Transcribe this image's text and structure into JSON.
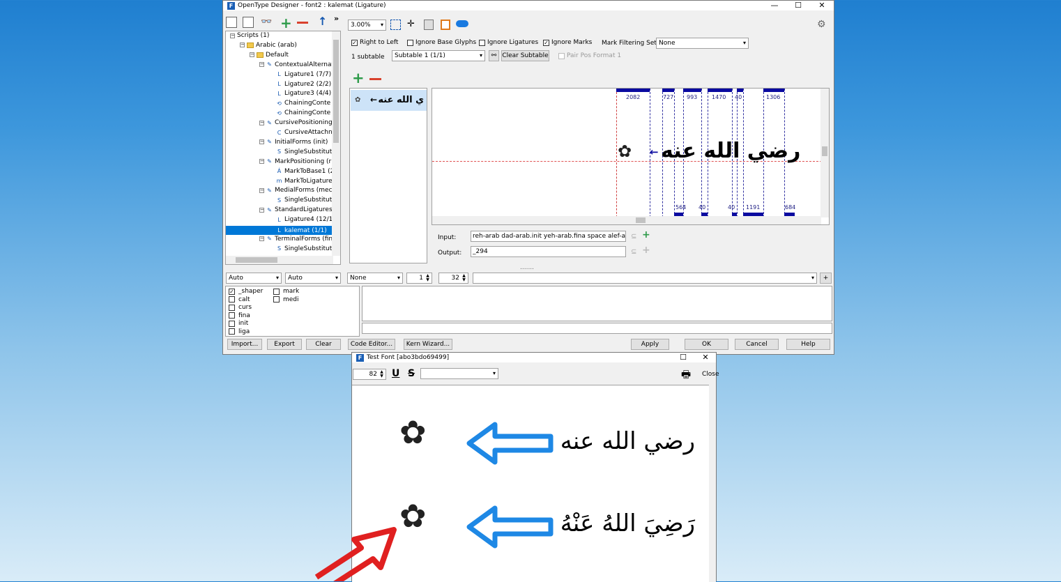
{
  "main_window": {
    "title": "OpenType Designer - font2 : kalemat (Ligature)",
    "min": "—",
    "max": "☐",
    "close": "✕"
  },
  "toolbar": {
    "zoom_value": "3.00%"
  },
  "lookup_options": {
    "right_to_left": "Right to Left",
    "ignore_base_glyphs": "Ignore Base Glyphs",
    "ignore_ligatures": "Ignore Ligatures",
    "ignore_marks": "Ignore Marks",
    "mark_filtering_set_label": "Mark Filtering Set:",
    "mark_filtering_set_value": "None",
    "subtable_count": "1 subtable",
    "subtable_value": "Subtable 1 (1/1)",
    "clear_subtable": "Clear Subtable",
    "pair_pos_format": "Pair Pos Format 1"
  },
  "tree": [
    {
      "label": "Scripts (1)",
      "depth": 0,
      "pm": "⊟",
      "icon": ""
    },
    {
      "label": "Arabic (arab)",
      "depth": 1,
      "pm": "⊟",
      "icon": "folder"
    },
    {
      "label": "Default",
      "depth": 2,
      "pm": "⊟",
      "icon": "folder"
    },
    {
      "label": "ContextualAlternat",
      "depth": 3,
      "pm": "⊟",
      "icon": "✎"
    },
    {
      "label": "Ligature1 (7/7)",
      "depth": 4,
      "pm": "",
      "icon": "L"
    },
    {
      "label": "Ligature2 (2/2)",
      "depth": 4,
      "pm": "",
      "icon": "L"
    },
    {
      "label": "Ligature3 (4/4)",
      "depth": 4,
      "pm": "",
      "icon": "L"
    },
    {
      "label": "ChainingConte",
      "depth": 4,
      "pm": "",
      "icon": "⟲"
    },
    {
      "label": "ChainingConte",
      "depth": 4,
      "pm": "",
      "icon": "⟲"
    },
    {
      "label": "CursivePositioning",
      "depth": 3,
      "pm": "⊟",
      "icon": "✎"
    },
    {
      "label": "CursiveAttachn",
      "depth": 4,
      "pm": "",
      "icon": "C"
    },
    {
      "label": "InitialForms (init)",
      "depth": 3,
      "pm": "⊟",
      "icon": "✎"
    },
    {
      "label": "SingleSubstitut",
      "depth": 4,
      "pm": "",
      "icon": "S"
    },
    {
      "label": "MarkPositioning (r",
      "depth": 3,
      "pm": "⊟",
      "icon": "✎"
    },
    {
      "label": "MarkToBase1 (2",
      "depth": 4,
      "pm": "",
      "icon": "Á"
    },
    {
      "label": "MarkToLigature",
      "depth": 4,
      "pm": "",
      "icon": "m"
    },
    {
      "label": "MedialForms (mec",
      "depth": 3,
      "pm": "⊟",
      "icon": "✎"
    },
    {
      "label": "SingleSubstitut",
      "depth": 4,
      "pm": "",
      "icon": "S"
    },
    {
      "label": "StandardLigatures",
      "depth": 3,
      "pm": "⊟",
      "icon": "✎"
    },
    {
      "label": "Ligature4 (12/1",
      "depth": 4,
      "pm": "",
      "icon": "L"
    },
    {
      "label": "kalemat (1/1)",
      "depth": 4,
      "pm": "",
      "icon": "L",
      "selected": true
    },
    {
      "label": "TerminalForms (fin",
      "depth": 3,
      "pm": "⊟",
      "icon": "✎"
    },
    {
      "label": "SingleSubstitut",
      "depth": 4,
      "pm": "",
      "icon": "S"
    }
  ],
  "glyph_list": {
    "entry_left": "ي الله عنه",
    "entry_arrow": "←"
  },
  "preview": {
    "top_numbers": [
      "2082",
      "727",
      "993",
      "1470",
      "40",
      "1306"
    ],
    "bottom_numbers": [
      "564",
      "40",
      "40",
      "1191",
      "684"
    ],
    "text": "رضي الله عنه",
    "arrow": "←"
  },
  "io": {
    "input_label": "Input:",
    "input_value": "reh-arab dad-arab.init yeh-arab.fina space alef-arab al",
    "output_label": "Output:",
    "output_value": "_294"
  },
  "bottom_controls": {
    "script": "Auto",
    "language": "Auto",
    "direction": "None",
    "size1": "1",
    "size2": "32",
    "add": "+"
  },
  "features_col1": [
    {
      "name": "_shaper",
      "checked": true
    },
    {
      "name": "calt",
      "checked": false
    },
    {
      "name": "curs",
      "checked": false
    },
    {
      "name": "fina",
      "checked": false
    },
    {
      "name": "init",
      "checked": false
    },
    {
      "name": "liga",
      "checked": false
    }
  ],
  "features_col2": [
    {
      "name": "mark",
      "checked": false
    },
    {
      "name": "medi",
      "checked": false
    }
  ],
  "buttons": {
    "import": "Import...",
    "export": "Export",
    "clear": "Clear",
    "code_editor": "Code Editor...",
    "kern_wizard": "Kern Wizard...",
    "apply": "Apply",
    "ok": "OK",
    "cancel": "Cancel",
    "help": "Help"
  },
  "test_window": {
    "title": "Test Font [abo3bdo69499]",
    "size": "82",
    "underline": "U",
    "strike": "S",
    "close": "Close",
    "line1": "رضي الله عنه",
    "line2": "رَضِيَ اللهُ عَنْهُ",
    "arrow_color": "#1e88e5",
    "red_arrow_color": "#e02020"
  }
}
